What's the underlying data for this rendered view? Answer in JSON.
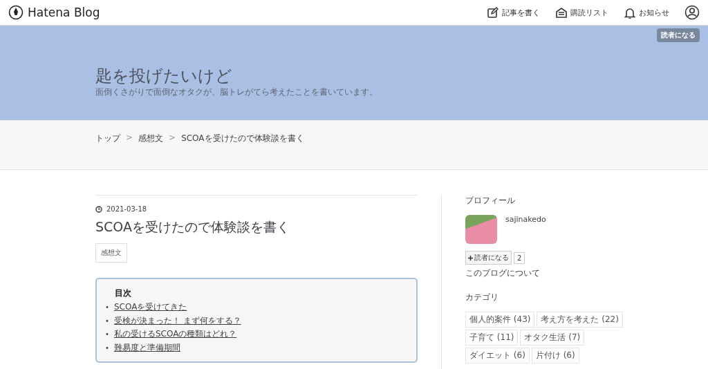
{
  "header": {
    "logo": "Hatena Blog",
    "nav": [
      {
        "label": "記事を書く"
      },
      {
        "label": "購読リスト"
      },
      {
        "label": "お知らせ"
      }
    ]
  },
  "banner": {
    "subscribe": "読者になる",
    "title": "匙を投げたいけど",
    "description": "面倒くさがりで面倒なオタクが、脳トレがてら考えたことを書いています。"
  },
  "breadcrumb": [
    "トップ",
    "感想文",
    "SCOAを受けたので体験談を書く"
  ],
  "breadcrumb_separator": ">",
  "article": {
    "date": "2021-03-18",
    "title": "SCOAを受けたので体験談を書く",
    "categories": [
      "感想文"
    ],
    "toc": {
      "heading": "目次",
      "bullet": "•",
      "items": [
        "SCOAを受けてきた",
        "受検が決まった！ まず何をする？",
        "私の受けるSCOAの種類はどれ？",
        "難易度と準備期間"
      ]
    }
  },
  "sidebar": {
    "profile": {
      "heading": "プロフィール",
      "username": "sajinakedo",
      "subscribe": "読者になる",
      "subscriber_count": "2",
      "about": "このブログについて"
    },
    "categories": {
      "heading": "カテゴリ",
      "items": [
        "個人的案件 (43)",
        "考え方を考えた (22)",
        "子育て (11)",
        "オタク生活 (7)",
        "ダイエット (6)",
        "片付け (6)"
      ]
    }
  }
}
